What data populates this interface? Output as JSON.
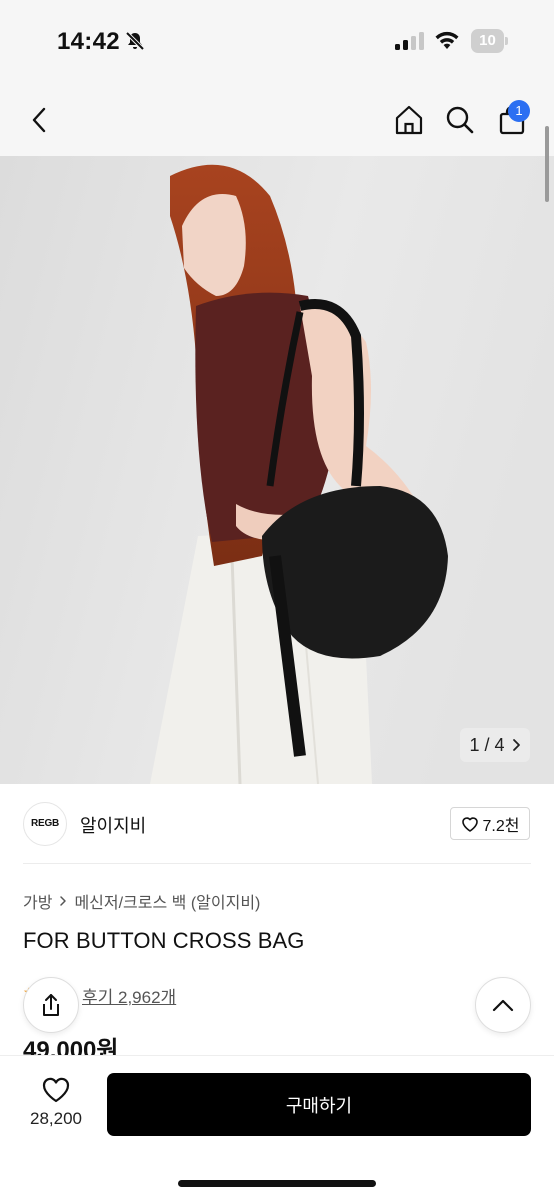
{
  "status_bar": {
    "time": "14:42",
    "battery": "10"
  },
  "nav": {
    "cart_badge": "1"
  },
  "hero": {
    "image_counter": "1 / 4"
  },
  "brand": {
    "logo_text": "REGB",
    "name": "알이지비",
    "likes": "7.2천"
  },
  "breadcrumb": {
    "category": "가방",
    "subcategory": "메신저/크로스 백 (알이지비)"
  },
  "product": {
    "title": "FOR BUTTON CROSS BAG",
    "reviews": "후기 2,962개",
    "price": "49,000원"
  },
  "bottom_bar": {
    "wish_count": "28,200",
    "buy_label": "구매하기"
  },
  "colors": {
    "badge": "#2b6ff2",
    "buy_button": "#000000"
  }
}
